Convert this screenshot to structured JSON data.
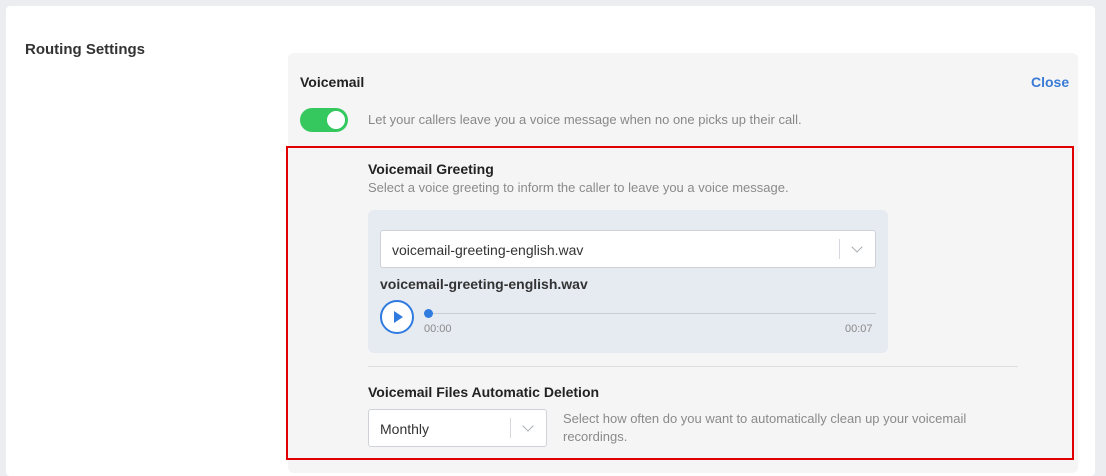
{
  "routing": {
    "title": "Routing Settings"
  },
  "voicemail": {
    "title": "Voicemail",
    "close_label": "Close",
    "toggle_enabled": true,
    "toggle_description": "Let your callers leave you a voice message when no one picks up their call."
  },
  "greeting": {
    "title": "Voicemail Greeting",
    "description": "Select a voice greeting to inform the caller to leave you a voice message.",
    "selected_file": "voicemail-greeting-english.wav",
    "player": {
      "file_name": "voicemail-greeting-english.wav",
      "current_time": "00:00",
      "duration": "00:07",
      "progress": 0
    }
  },
  "deletion": {
    "title": "Voicemail Files Automatic Deletion",
    "selected_frequency": "Monthly",
    "description": "Select how often do you want to automatically clean up your voicemail recordings."
  },
  "colors": {
    "accent": "#2f7be0",
    "toggle_on": "#35c85f",
    "highlight_border": "#e00000",
    "link": "#3a7bd5"
  },
  "icons": {
    "play": "play-icon",
    "dropdown": "chevron-down-icon"
  }
}
